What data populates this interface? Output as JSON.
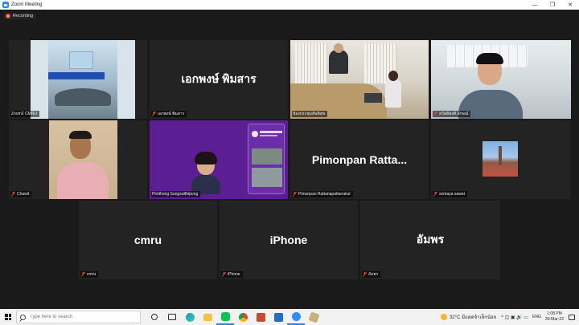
{
  "window": {
    "title": "Zoom Meeting"
  },
  "recording": {
    "label": "Recording"
  },
  "tiles": {
    "zoom2": {
      "label": "Zoom2 CMRU"
    },
    "ekapong": {
      "name": "เอกพงษ์ พิมสาร",
      "label": "เอกพงษ์ พิมสาร"
    },
    "meeting_room": {
      "label": "ห้องประชุมสันติสุข"
    },
    "row1_right": {
      "label": "สวัสดิพงศ์ ลักษณ์"
    },
    "chawit": {
      "label": "Chawit"
    },
    "pimthong": {
      "label": "Pimthong Sungsutthipong"
    },
    "pimonpan": {
      "name": "Pimonpan  Ratta...",
      "label": "Pimonpan Rattanapattanakul"
    },
    "sontaya": {
      "label": "sontaya sawat"
    },
    "cmru": {
      "name": "cmru",
      "label": "cmru"
    },
    "iphone": {
      "name": "iPhone",
      "label": "iPhone"
    },
    "amporn": {
      "name": "อัมพร",
      "label": "อัมพร"
    }
  },
  "taskbar": {
    "search_placeholder": "Type here to search",
    "weather": "32°C  มีแดดจ้าเล็กน้อย",
    "lang": "ENG",
    "time": "1:08 PM",
    "date": "30-Mar-22"
  },
  "colors": {
    "zoom_blue": "#2D8CFF",
    "active_speaker": "#c8e65a",
    "muted_red": "#e8452c"
  }
}
